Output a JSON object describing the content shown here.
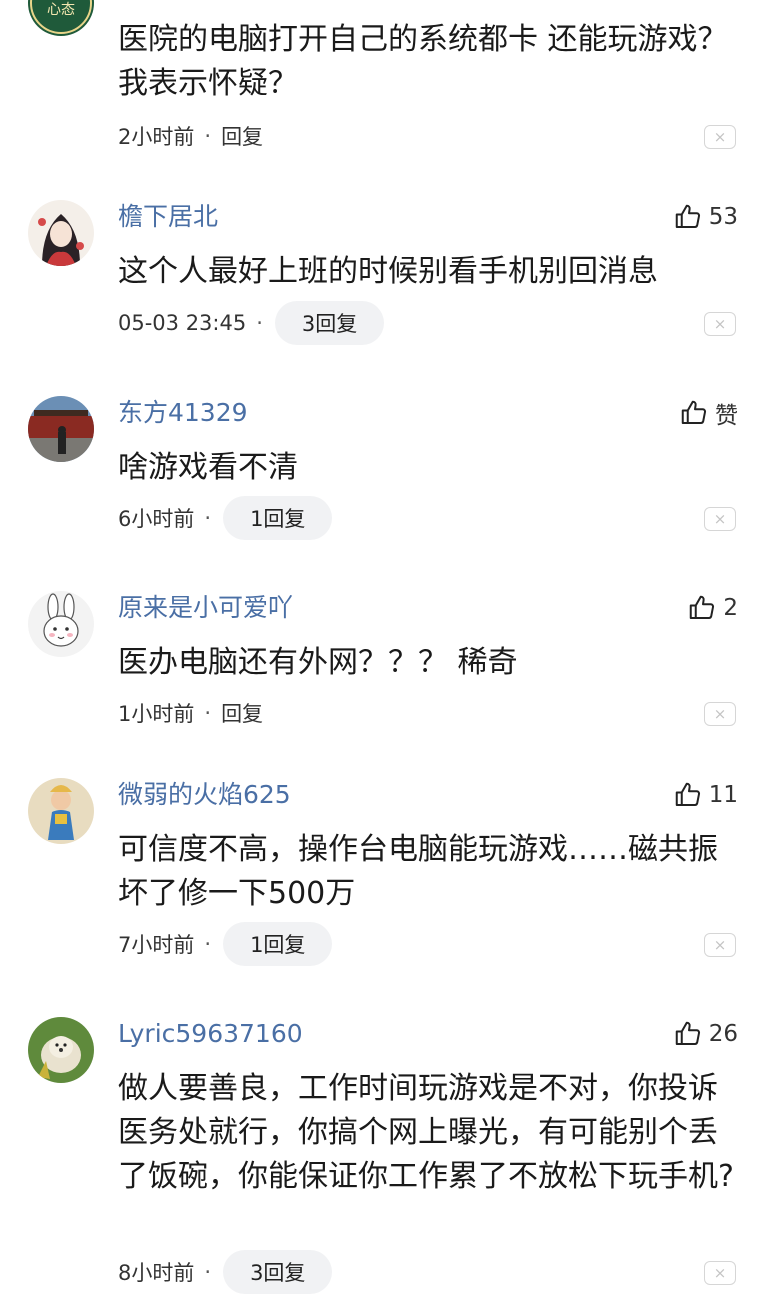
{
  "comments": [
    {
      "avatar": "badge-avatar",
      "avatar_text": "心态",
      "username": "",
      "likes": "",
      "text": "医院的电脑打开自己的系统都卡 还能玩游戏？我表示怀疑？",
      "time": "2小时前",
      "reply": "回复",
      "reply_count": ""
    },
    {
      "avatar": "girl-avatar",
      "username": "檐下居北",
      "likes": "53",
      "text": "这个人最好上班的时候别看手机别回消息",
      "time": "05-03 23:45",
      "reply_count": "3回复"
    },
    {
      "avatar": "building-avatar",
      "username": "东方41329",
      "likes": "赞",
      "text": "啥游戏看不清",
      "time": "6小时前",
      "reply_count": "1回复"
    },
    {
      "avatar": "rabbit-avatar",
      "username": "原来是小可爱吖",
      "likes": "2",
      "text": "医办电脑还有外网？？？ 稀奇",
      "time": "1小时前",
      "reply": "回复"
    },
    {
      "avatar": "character-avatar",
      "username": "微弱的火焰625",
      "likes": "11",
      "text": "可信度不高，操作台电脑能玩游戏……磁共振坏了修一下500万",
      "time": "7小时前",
      "reply_count": "1回复"
    },
    {
      "avatar": "dog-avatar",
      "username": "Lyric59637160",
      "likes": "26",
      "text": "做人要善良，工作时间玩游戏是不对，你投诉医务处就行，你搞个网上曝光，有可能别个丢了饭碗，你能保证你工作累了不放松下玩手机?",
      "time": "8小时前",
      "reply_count": "3回复"
    }
  ],
  "colors": {
    "username": "#4a6fa5",
    "text": "#1a1a1a",
    "pill_bg": "#f1f2f4"
  },
  "icons": {
    "like": "thumbs-up-icon",
    "close": "close-icon"
  },
  "close_glyph": "×",
  "dot": "·"
}
